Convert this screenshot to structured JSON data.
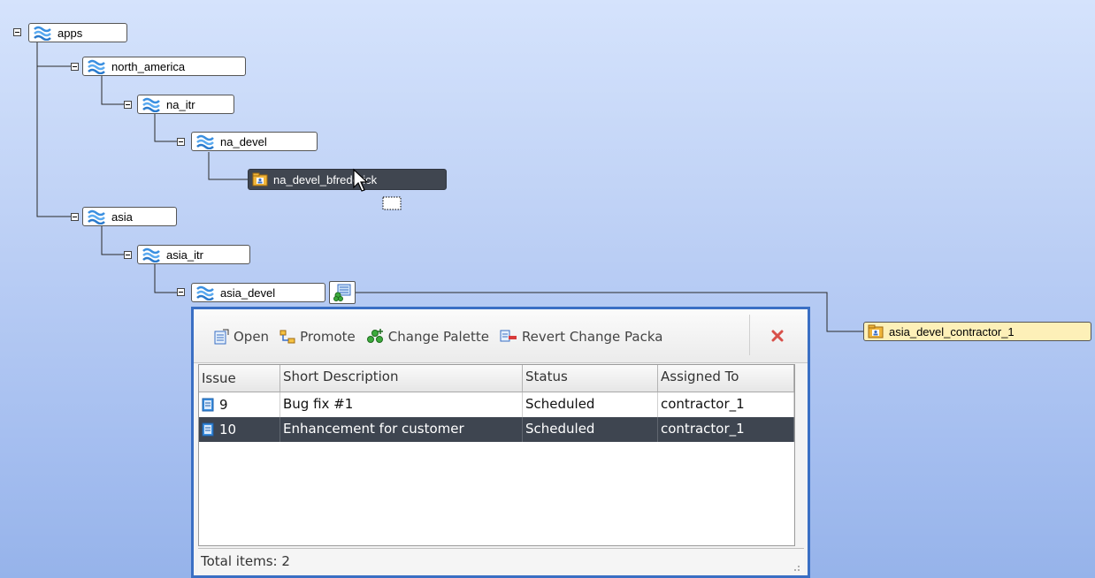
{
  "tree": {
    "nodes": [
      {
        "id": "apps",
        "label": "apps"
      },
      {
        "id": "north_america",
        "label": "north_america"
      },
      {
        "id": "na_itr",
        "label": "na_itr"
      },
      {
        "id": "na_devel",
        "label": "na_devel"
      },
      {
        "id": "na_devel_bfrederick",
        "label": "na_devel_bfrederick"
      },
      {
        "id": "asia",
        "label": "asia"
      },
      {
        "id": "asia_itr",
        "label": "asia_itr"
      },
      {
        "id": "asia_devel",
        "label": "asia_devel"
      },
      {
        "id": "asia_devel_contractor_1",
        "label": "asia_devel_contractor_1"
      }
    ]
  },
  "popup": {
    "toolbar": {
      "open_label": "Open",
      "promote_label": "Promote",
      "change_palette_label": "Change Palette",
      "revert_label": "Revert Change Packa"
    },
    "table": {
      "headers": [
        "Issue",
        "Short Description",
        "Status",
        "Assigned To"
      ],
      "rows": [
        {
          "issue": "9",
          "description": "Bug fix #1",
          "status": "Scheduled",
          "assigned": "contractor_1"
        },
        {
          "issue": "10",
          "description": "Enhancement for customer",
          "status": "Scheduled",
          "assigned": "contractor_1"
        }
      ]
    },
    "status_text": "Total items: 2"
  },
  "colors": {
    "accent_border": "#3a6fc4",
    "selected_bg": "#404650",
    "workspace_bg": "#fdf0b8"
  }
}
